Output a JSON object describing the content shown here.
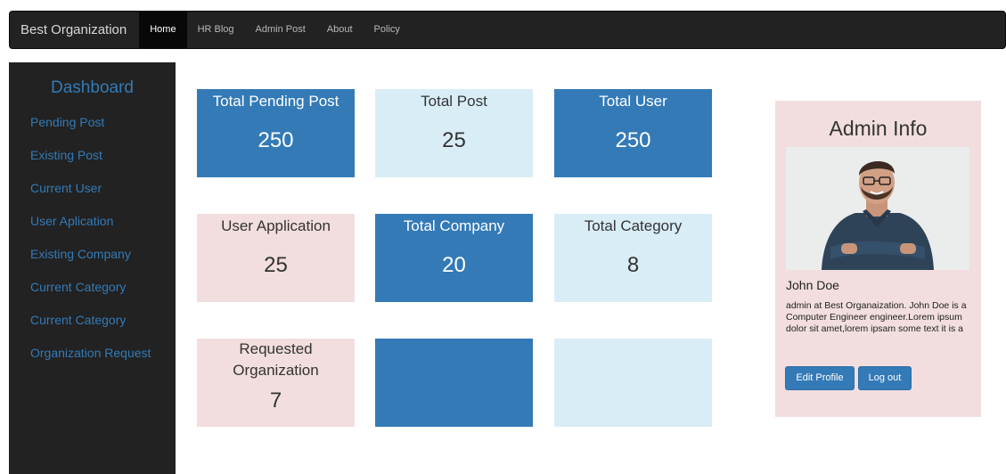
{
  "navbar": {
    "brand": "Best Organization",
    "items": [
      {
        "label": "Home",
        "active": true
      },
      {
        "label": "HR Blog",
        "active": false
      },
      {
        "label": "Admin Post",
        "active": false
      },
      {
        "label": "About",
        "active": false
      },
      {
        "label": "Policy",
        "active": false
      }
    ]
  },
  "sidebar": {
    "title": "Dashboard",
    "links": [
      "Pending Post",
      "Existing Post",
      "Current User",
      "User Aplication",
      "Existing Company",
      "Current Category",
      "Current Category",
      "Organization Request"
    ]
  },
  "tiles": [
    {
      "label": "Total Pending Post",
      "value": "250",
      "color": "blue"
    },
    {
      "label": "Total Post",
      "value": "25",
      "color": "lightblue"
    },
    {
      "label": "Total User",
      "value": "250",
      "color": "blue"
    },
    {
      "label": "User Application",
      "value": "25",
      "color": "pink"
    },
    {
      "label": "Total Company",
      "value": "20",
      "color": "blue"
    },
    {
      "label": "Total Category",
      "value": "8",
      "color": "lightblue"
    },
    {
      "label": "Requested Organization",
      "value": "7",
      "color": "pink"
    },
    {
      "label": "",
      "value": "",
      "color": "blue"
    },
    {
      "label": "",
      "value": "",
      "color": "lightblue"
    }
  ],
  "admin": {
    "title": "Admin Info",
    "name": "John Doe",
    "description": "admin at Best Organaization. John Doe is a Computer Engineer engineer.Lorem ipsum dolor sit amet,lorem ipsam some text it is a",
    "edit_label": "Edit Profile",
    "logout_label": "Log out"
  },
  "colors": {
    "primary": "#337ab7",
    "light_blue": "#d9edf7",
    "pink": "#f2dede",
    "navbar": "#222222"
  }
}
